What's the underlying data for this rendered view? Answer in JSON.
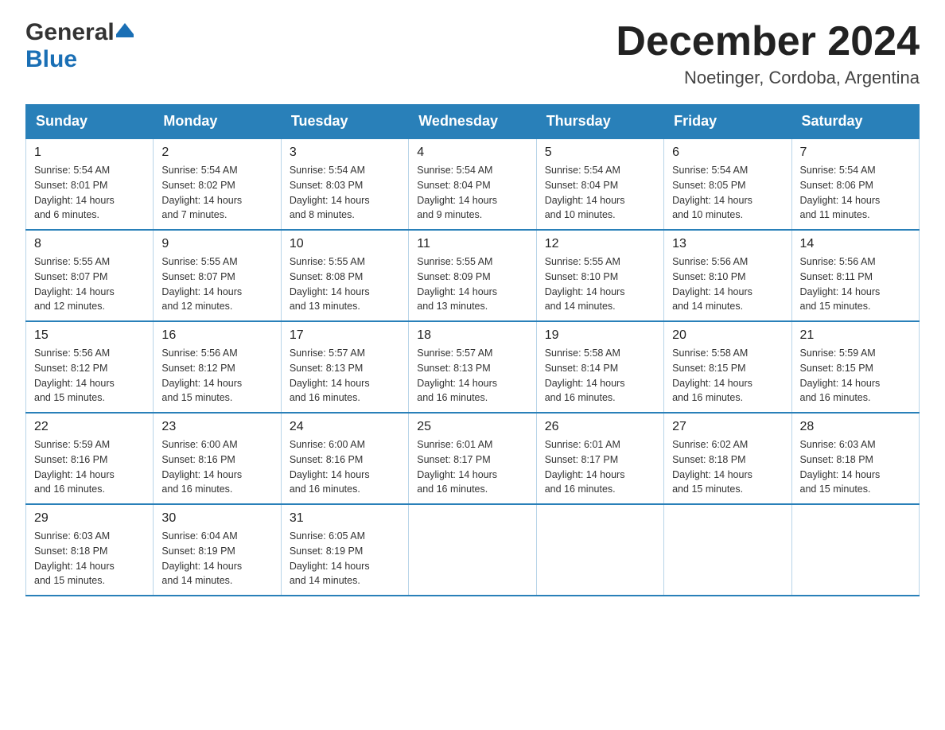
{
  "header": {
    "logo_general": "General",
    "logo_blue": "Blue",
    "month_year": "December 2024",
    "location": "Noetinger, Cordoba, Argentina"
  },
  "days_of_week": [
    "Sunday",
    "Monday",
    "Tuesday",
    "Wednesday",
    "Thursday",
    "Friday",
    "Saturday"
  ],
  "weeks": [
    [
      {
        "day": "1",
        "sunrise": "5:54 AM",
        "sunset": "8:01 PM",
        "daylight": "14 hours and 6 minutes."
      },
      {
        "day": "2",
        "sunrise": "5:54 AM",
        "sunset": "8:02 PM",
        "daylight": "14 hours and 7 minutes."
      },
      {
        "day": "3",
        "sunrise": "5:54 AM",
        "sunset": "8:03 PM",
        "daylight": "14 hours and 8 minutes."
      },
      {
        "day": "4",
        "sunrise": "5:54 AM",
        "sunset": "8:04 PM",
        "daylight": "14 hours and 9 minutes."
      },
      {
        "day": "5",
        "sunrise": "5:54 AM",
        "sunset": "8:04 PM",
        "daylight": "14 hours and 10 minutes."
      },
      {
        "day": "6",
        "sunrise": "5:54 AM",
        "sunset": "8:05 PM",
        "daylight": "14 hours and 10 minutes."
      },
      {
        "day": "7",
        "sunrise": "5:54 AM",
        "sunset": "8:06 PM",
        "daylight": "14 hours and 11 minutes."
      }
    ],
    [
      {
        "day": "8",
        "sunrise": "5:55 AM",
        "sunset": "8:07 PM",
        "daylight": "14 hours and 12 minutes."
      },
      {
        "day": "9",
        "sunrise": "5:55 AM",
        "sunset": "8:07 PM",
        "daylight": "14 hours and 12 minutes."
      },
      {
        "day": "10",
        "sunrise": "5:55 AM",
        "sunset": "8:08 PM",
        "daylight": "14 hours and 13 minutes."
      },
      {
        "day": "11",
        "sunrise": "5:55 AM",
        "sunset": "8:09 PM",
        "daylight": "14 hours and 13 minutes."
      },
      {
        "day": "12",
        "sunrise": "5:55 AM",
        "sunset": "8:10 PM",
        "daylight": "14 hours and 14 minutes."
      },
      {
        "day": "13",
        "sunrise": "5:56 AM",
        "sunset": "8:10 PM",
        "daylight": "14 hours and 14 minutes."
      },
      {
        "day": "14",
        "sunrise": "5:56 AM",
        "sunset": "8:11 PM",
        "daylight": "14 hours and 15 minutes."
      }
    ],
    [
      {
        "day": "15",
        "sunrise": "5:56 AM",
        "sunset": "8:12 PM",
        "daylight": "14 hours and 15 minutes."
      },
      {
        "day": "16",
        "sunrise": "5:56 AM",
        "sunset": "8:12 PM",
        "daylight": "14 hours and 15 minutes."
      },
      {
        "day": "17",
        "sunrise": "5:57 AM",
        "sunset": "8:13 PM",
        "daylight": "14 hours and 16 minutes."
      },
      {
        "day": "18",
        "sunrise": "5:57 AM",
        "sunset": "8:13 PM",
        "daylight": "14 hours and 16 minutes."
      },
      {
        "day": "19",
        "sunrise": "5:58 AM",
        "sunset": "8:14 PM",
        "daylight": "14 hours and 16 minutes."
      },
      {
        "day": "20",
        "sunrise": "5:58 AM",
        "sunset": "8:15 PM",
        "daylight": "14 hours and 16 minutes."
      },
      {
        "day": "21",
        "sunrise": "5:59 AM",
        "sunset": "8:15 PM",
        "daylight": "14 hours and 16 minutes."
      }
    ],
    [
      {
        "day": "22",
        "sunrise": "5:59 AM",
        "sunset": "8:16 PM",
        "daylight": "14 hours and 16 minutes."
      },
      {
        "day": "23",
        "sunrise": "6:00 AM",
        "sunset": "8:16 PM",
        "daylight": "14 hours and 16 minutes."
      },
      {
        "day": "24",
        "sunrise": "6:00 AM",
        "sunset": "8:16 PM",
        "daylight": "14 hours and 16 minutes."
      },
      {
        "day": "25",
        "sunrise": "6:01 AM",
        "sunset": "8:17 PM",
        "daylight": "14 hours and 16 minutes."
      },
      {
        "day": "26",
        "sunrise": "6:01 AM",
        "sunset": "8:17 PM",
        "daylight": "14 hours and 16 minutes."
      },
      {
        "day": "27",
        "sunrise": "6:02 AM",
        "sunset": "8:18 PM",
        "daylight": "14 hours and 15 minutes."
      },
      {
        "day": "28",
        "sunrise": "6:03 AM",
        "sunset": "8:18 PM",
        "daylight": "14 hours and 15 minutes."
      }
    ],
    [
      {
        "day": "29",
        "sunrise": "6:03 AM",
        "sunset": "8:18 PM",
        "daylight": "14 hours and 15 minutes."
      },
      {
        "day": "30",
        "sunrise": "6:04 AM",
        "sunset": "8:19 PM",
        "daylight": "14 hours and 14 minutes."
      },
      {
        "day": "31",
        "sunrise": "6:05 AM",
        "sunset": "8:19 PM",
        "daylight": "14 hours and 14 minutes."
      },
      null,
      null,
      null,
      null
    ]
  ],
  "labels": {
    "sunrise": "Sunrise:",
    "sunset": "Sunset:",
    "daylight": "Daylight:"
  }
}
